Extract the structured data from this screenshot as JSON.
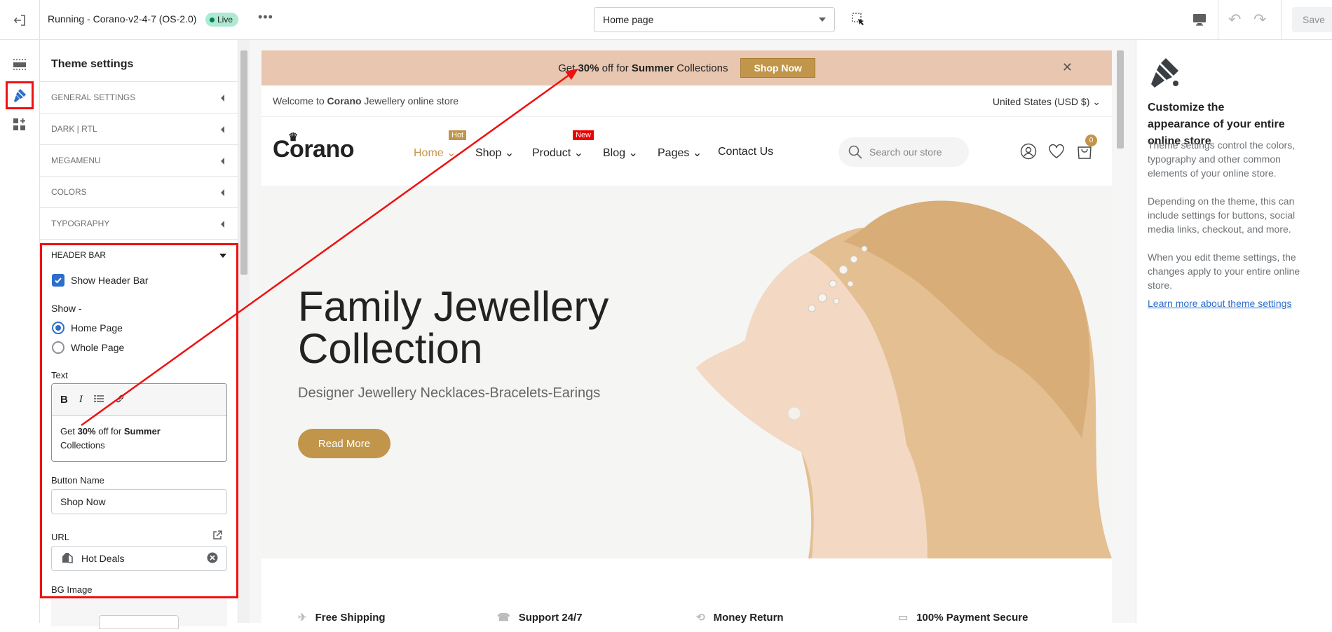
{
  "topbar": {
    "theme_name": "Running - Corano-v2-4-7 (OS-2.0)",
    "live_badge": "Live",
    "more": "•••",
    "page_select": "Home page",
    "undo": "↶",
    "redo": "↷",
    "save_label": "Save"
  },
  "sidebar": {
    "title": "Theme settings",
    "sections": [
      {
        "label": "GENERAL SETTINGS"
      },
      {
        "label": "DARK | RTL"
      },
      {
        "label": "MEGAMENU"
      },
      {
        "label": "COLORS"
      },
      {
        "label": "TYPOGRAPHY"
      },
      {
        "label": "HEADER BAR"
      }
    ],
    "header_bar": {
      "show_header_bar_label": "Show Header Bar",
      "show_header_bar_checked": true,
      "show_label": "Show -",
      "radio_options": [
        "Home Page",
        "Whole Page"
      ],
      "radio_selected": "Home Page",
      "text_label": "Text",
      "rte_text": {
        "get": "Get ",
        "pct": "30%",
        "off_for": " off for ",
        "summer": "Summer",
        "collections": "Collections"
      },
      "button_name_label": "Button Name",
      "button_name_value": "Shop Now",
      "url_label": "URL",
      "url_value": "Hot Deals",
      "bg_image_label": "BG Image"
    }
  },
  "store": {
    "announcement": {
      "get": "Get ",
      "pct": "30%",
      "off_for": " off for ",
      "summer": "Summer",
      "collections": " Collections",
      "button": "Shop Now",
      "close": "✕"
    },
    "welcome": {
      "pre": "Welcome to ",
      "brand": "Corano",
      "post": " Jewellery online store"
    },
    "currency": "United States (USD $)",
    "logo": "Corano",
    "nav": [
      {
        "label": "Home",
        "badge": "Hot",
        "badge_color": "#c1954a"
      },
      {
        "label": "Shop"
      },
      {
        "label": "Product",
        "badge": "New",
        "badge_color": "#e00"
      },
      {
        "label": "Blog"
      },
      {
        "label": "Pages"
      },
      {
        "label": "Contact Us"
      }
    ],
    "search_placeholder": "Search our store",
    "cart_count": "0",
    "hero": {
      "title_line1": "Family Jewellery",
      "title_line2": "Collection",
      "subtitle": "Designer Jewellery Necklaces-Bracelets-Earings",
      "button": "Read More"
    },
    "features": [
      "Free Shipping",
      "Support 24/7",
      "Money Return",
      "100% Payment Secure"
    ]
  },
  "right_panel": {
    "title": "Customize the appearance of your entire online store",
    "p1": "Theme settings control the colors, typography and other common elements of your online store.",
    "p2": "Depending on the theme, this can include settings for buttons, social media links, checkout, and more.",
    "p3": "When you edit theme settings, the changes apply to your entire online store.",
    "link": "Learn more about theme settings"
  },
  "colors": {
    "accent": "#2c6ecb",
    "gold": "#c1954a",
    "annotation": "#e11"
  }
}
